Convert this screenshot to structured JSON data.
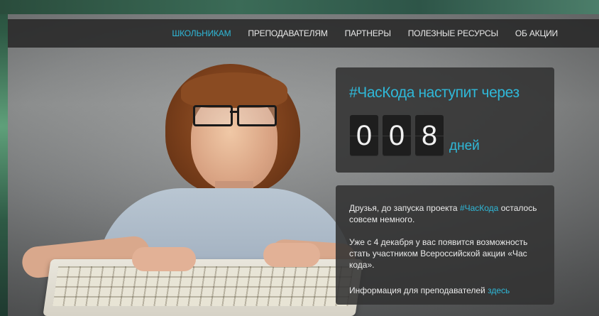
{
  "nav": {
    "items": [
      {
        "label": "ШКОЛЬНИКАМ",
        "active": true
      },
      {
        "label": "ПРЕПОДАВАТЕЛЯМ",
        "active": false
      },
      {
        "label": "ПАРТНЕРЫ",
        "active": false
      },
      {
        "label": "ПОЛЕЗНЫЕ РЕСУРСЫ",
        "active": false
      },
      {
        "label": "ОБ АКЦИИ",
        "active": false
      }
    ]
  },
  "countdown": {
    "title": "#ЧасКода наступит через",
    "digits": [
      "0",
      "0",
      "8"
    ],
    "unit": "дней"
  },
  "info": {
    "p1_before": "Друзья, до запуска проекта ",
    "p1_hashtag": "#ЧасКода",
    "p1_after": " осталось совсем немного.",
    "p2": "Уже с 4 декабря у вас появится возможность стать участником Всероссийской акции «Час кода».",
    "p3_text": "Информация для преподавателей ",
    "p3_link": "здесь"
  },
  "colors": {
    "accent": "#2fb8d8",
    "nav_bg": "#282828",
    "panel_bg": "#323232",
    "digit_bg": "#1e1e1e"
  }
}
